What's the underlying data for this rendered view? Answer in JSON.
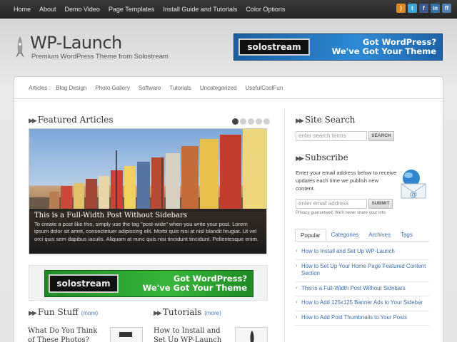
{
  "topnav": [
    "Home",
    "About",
    "Demo Video",
    "Page Templates",
    "Install Guide and Tutorials",
    "Color Options"
  ],
  "social_icons": [
    "rss-icon",
    "twitter-icon",
    "facebook-icon",
    "linkedin-icon",
    "friendfeed-icon"
  ],
  "logo": {
    "title": "WP-Launch",
    "tagline": "Premium WordPress Theme from Solostream"
  },
  "banner": {
    "brand": "solostream",
    "line1": "Got WordPress?",
    "line2": "We've Got Your Theme"
  },
  "catnav": [
    "Articles",
    "Blog Design",
    "Photo Gallery",
    "Software",
    "Tutorials",
    "Uncategorized",
    "UsefulCoolFun"
  ],
  "featured": {
    "heading": "Featured Articles",
    "caption_title": "This is a Full-Width Post Without Sidebars",
    "caption_body": "To create a post like this, simply use the tag \"post-wide\" when you write your post. Lorem ipsum dolor sit amet, consectetuer adipiscing elit. Morbi quis nisi at nisl blandit feugiat. Ut vel orci quis sem dapibus iaculis. Aliquam at nunc quis nisi tincidunt tincidunt. Pellentesque enim."
  },
  "fun_stuff": {
    "heading": "Fun Stuff",
    "more": "(more)",
    "post": "What Do You Think of These Photos?"
  },
  "tutorials": {
    "heading": "Tutorials",
    "more": "(more)",
    "post": "How to Install and Set Up WP-Launch"
  },
  "site_search": {
    "heading": "Site Search",
    "placeholder": "enter search terms",
    "button": "SEARCH"
  },
  "subscribe": {
    "heading": "Subscribe",
    "text": "Enter your email address below to receive updates each time we publish new content.",
    "placeholder": "enter email address",
    "button": "SUBMIT",
    "privacy": "Privacy guaranteed. We'll never share your info."
  },
  "tabs": [
    "Popular",
    "Categories",
    "Archives",
    "Tags"
  ],
  "popular_posts": [
    "How to Install and Set Up WP-Launch",
    "How to Set Up Your Home Page Featured Content Section",
    "This is a Full-Width Post Without Sidebars",
    "How to Add 125x125 Banner Ads to Your Sidebar",
    "How to Add Post Thumbnails to Your Posts"
  ]
}
